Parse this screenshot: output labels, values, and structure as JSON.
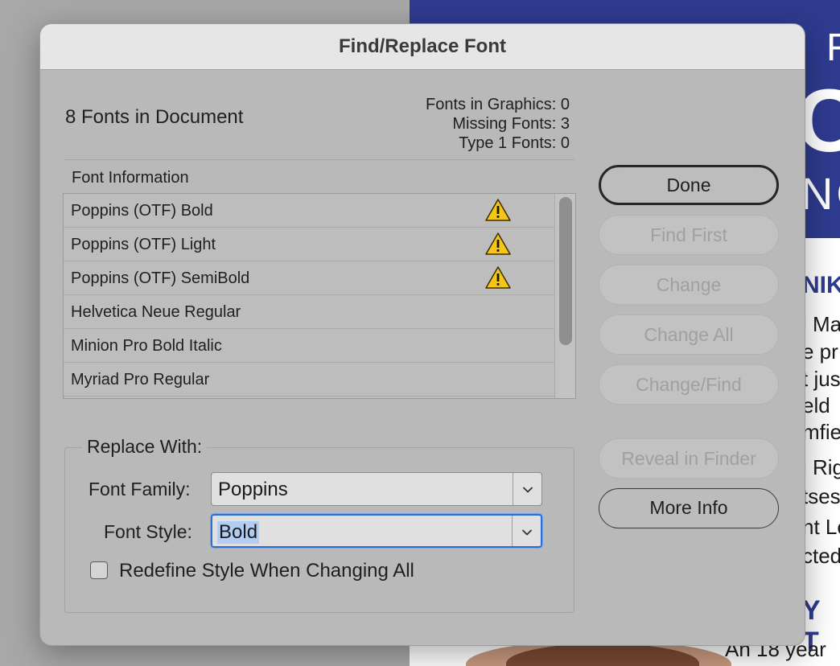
{
  "background_doc": {
    "banner_texts": [
      "F",
      "C",
      "NO"
    ],
    "headings": [
      "NIK",
      "Y T"
    ],
    "lines": [
      "l Ma",
      "e pr",
      "t jus",
      "eld",
      "mfie",
      "l Rig",
      "tses",
      "nt Le",
      "cted"
    ],
    "footer_line": "An 18 year"
  },
  "dialog": {
    "title": "Find/Replace Font",
    "fonts_count": "8 Fonts in Document",
    "stats": [
      "Fonts in Graphics: 0",
      "Missing Fonts: 3",
      "Type 1 Fonts: 0"
    ],
    "list_header": "Font Information",
    "fonts": [
      {
        "name": "Poppins (OTF) Bold",
        "missing": true
      },
      {
        "name": "Poppins (OTF) Light",
        "missing": true
      },
      {
        "name": "Poppins (OTF) SemiBold",
        "missing": true
      },
      {
        "name": "Helvetica Neue Regular",
        "missing": false
      },
      {
        "name": "Minion Pro Bold Italic",
        "missing": false
      },
      {
        "name": "Myriad Pro Regular",
        "missing": false
      }
    ],
    "buttons": {
      "done": "Done",
      "find_first": "Find First",
      "change": "Change",
      "change_all": "Change All",
      "change_find": "Change/Find",
      "reveal_in_finder": "Reveal in Finder",
      "more_info": "More Info"
    },
    "replace": {
      "group_title": "Replace With:",
      "font_family_label": "Font Family:",
      "font_family_value": "Poppins",
      "font_style_label": "Font Style:",
      "font_style_value": "Bold",
      "redefine_label": "Redefine Style When Changing All",
      "redefine_checked": false
    }
  },
  "colors": {
    "banner": "#2e3b8f",
    "warning": "#f5c518",
    "focus": "#2b6fd6"
  }
}
